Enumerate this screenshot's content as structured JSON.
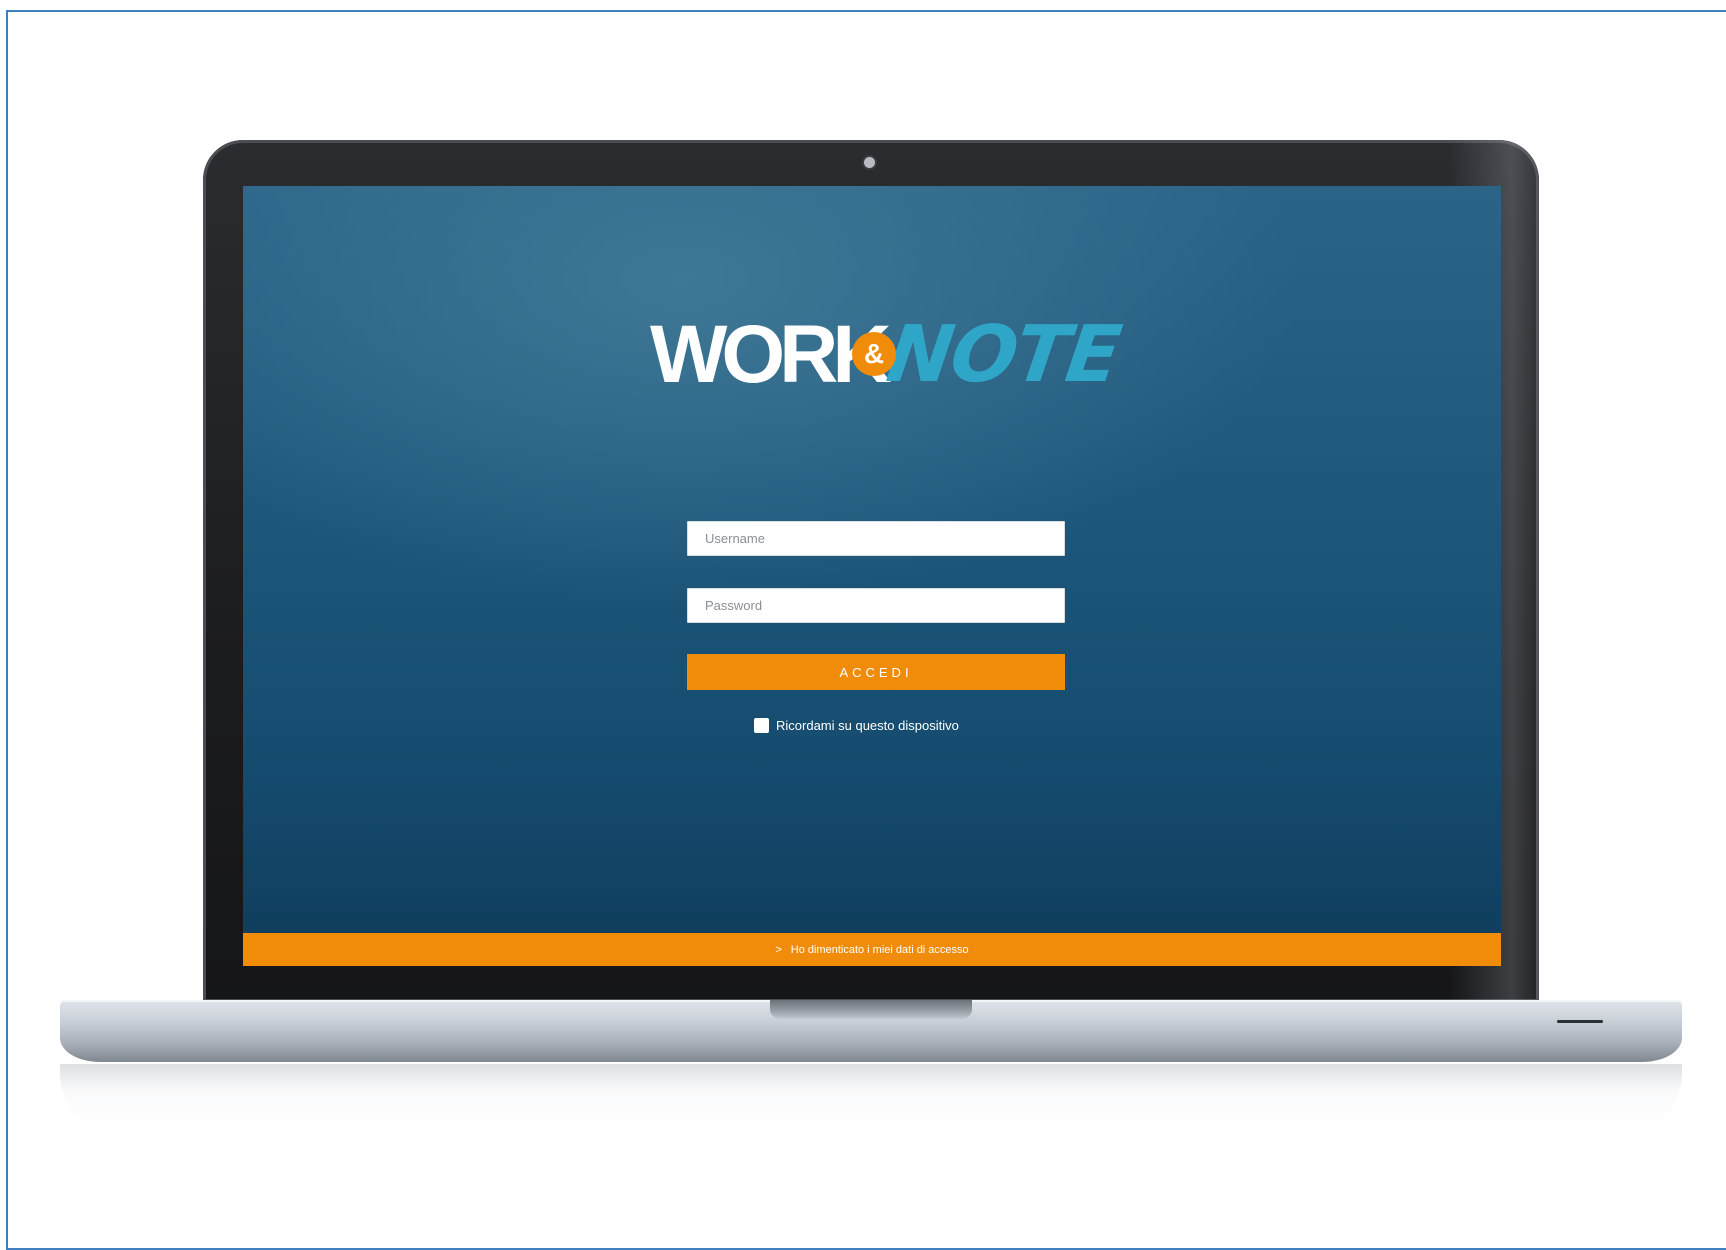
{
  "app": {
    "logo": {
      "work_text": "WORK",
      "ampersand": "&",
      "note_text": "NOTE"
    }
  },
  "login_form": {
    "username": {
      "placeholder": "Username",
      "value": ""
    },
    "password": {
      "placeholder": "Password",
      "value": ""
    },
    "submit_label": "ACCEDI",
    "remember_label": "Ricordami su questo dispositivo",
    "remember_checked": false
  },
  "footer": {
    "chevron": ">",
    "forgot_link": "Ho dimenticato i miei dati di accesso"
  },
  "colors": {
    "accent": "#f08c0a",
    "screen_background": "#1d5679",
    "logo_note": "#2fa6c8"
  },
  "icons": {
    "camera": "camera-icon",
    "forgot_chevron": "chevron-right-icon"
  }
}
